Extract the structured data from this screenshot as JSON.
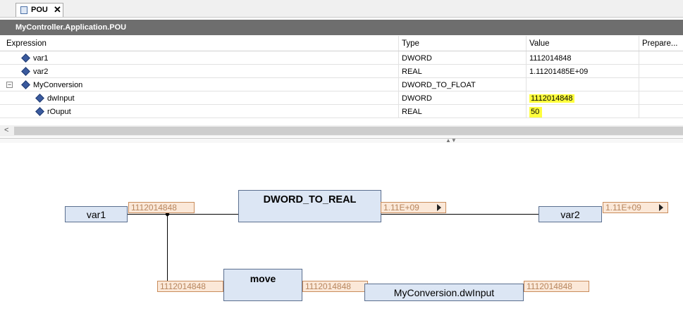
{
  "tab": {
    "label": "POU",
    "icon": "pou-file-icon"
  },
  "title": "MyController.Application.POU",
  "table": {
    "headers": [
      "Expression",
      "Type",
      "Value",
      "Prepare..."
    ],
    "rows": [
      {
        "expression": "var1",
        "type": "DWORD",
        "value": "1112014848"
      },
      {
        "expression": "var2",
        "type": "REAL",
        "value": "1.11201485E+09"
      },
      {
        "expression": "MyConversion",
        "type": "DWORD_TO_FLOAT",
        "value": ""
      },
      {
        "expression": "dwInput",
        "type": "DWORD",
        "value": "1112014848"
      },
      {
        "expression": "rOuput",
        "type": "REAL",
        "value": "50"
      }
    ],
    "expander_symbol": "−"
  },
  "scroll": {
    "left_arrow": "<"
  },
  "fbd": {
    "var1": "var1",
    "var1_value": "1112014848",
    "dword_to_real": "DWORD_TO_REAL",
    "dtr_output_value": "1.11E+09",
    "var2": "var2",
    "var2_value": "1.11E+09",
    "move": "move",
    "move_input_value": "1112014848",
    "move_output_value": "1112014848",
    "target": "MyConversion.dwInput",
    "target_value": "1112014848"
  },
  "colors": {
    "highlight": "#ffff3c",
    "titlebar": "#6e6e6e",
    "block_fill": "#dce6f4",
    "value_fill": "#fbe8d8"
  }
}
